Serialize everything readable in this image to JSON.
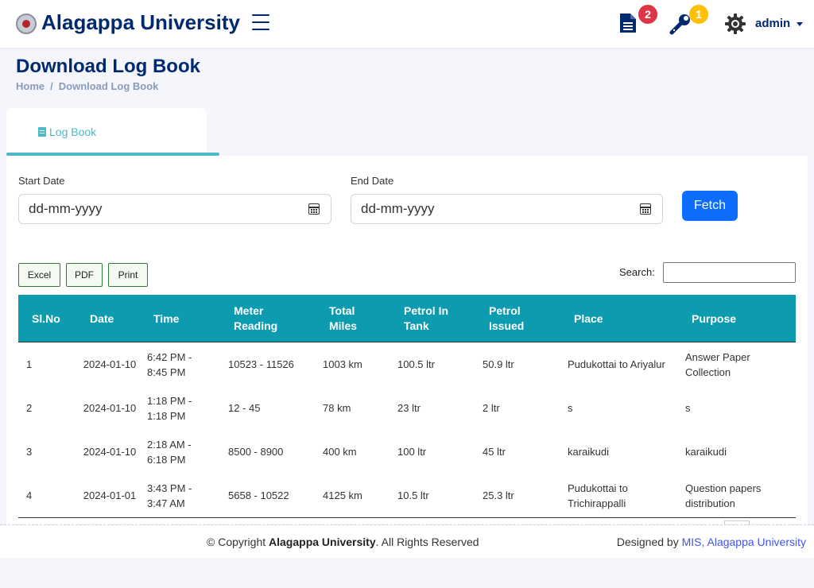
{
  "header": {
    "brand": "Alagappa University",
    "notifications_count": "2",
    "tools_count": "1",
    "user": "admin"
  },
  "page": {
    "title": "Download Log Book",
    "breadcrumb": [
      "Home",
      "Download Log Book"
    ]
  },
  "tab": {
    "label": "Log Book"
  },
  "filters": {
    "start_label": "Start Date",
    "start_value": "dd-mm-yyyy",
    "end_label": "End Date",
    "end_value": "dd-mm-yyyy",
    "fetch_label": "Fetch"
  },
  "export": {
    "excel": "Excel",
    "pdf": "PDF",
    "print": "Print"
  },
  "search": {
    "label": "Search:"
  },
  "table": {
    "columns": [
      "Sl.No",
      "Date",
      "Time",
      "Meter Reading",
      "Total Miles",
      "Petrol In Tank",
      "Petrol Issued",
      "Place",
      "Purpose"
    ],
    "rows": [
      [
        "1",
        "2024-01-10",
        "6:42 PM - 8:45 PM",
        "10523 - 11526",
        "1003 km",
        "100.5 ltr",
        "50.9 ltr",
        "Pudukottai to Ariyalur",
        "Answer Paper Collection"
      ],
      [
        "2",
        "2024-01-10",
        "1:18 PM - 1:18 PM",
        "12 - 45",
        "78 km",
        "23 ltr",
        "2 ltr",
        "s",
        "s"
      ],
      [
        "3",
        "2024-01-10",
        "2:18 AM - 6:18 PM",
        "8500 - 8900",
        "400 km",
        "100 ltr",
        "45 ltr",
        "karaikudi",
        "karaikudi"
      ],
      [
        "4",
        "2024-01-01",
        "3:43 PM - 3:47 AM",
        "5658 - 10522",
        "4125 km",
        "10.5 ltr",
        "25.3 ltr",
        "Pudukottai to Trichirappalli",
        "Question papers distribution"
      ]
    ]
  },
  "footer": {
    "copyright_prefix": "© Copyright",
    "copyright_org": "Alagappa University",
    "copyright_suffix": ". All Rights Reserved",
    "designed_by": "Designed by",
    "designed_link": "MIS, Alagappa University"
  }
}
